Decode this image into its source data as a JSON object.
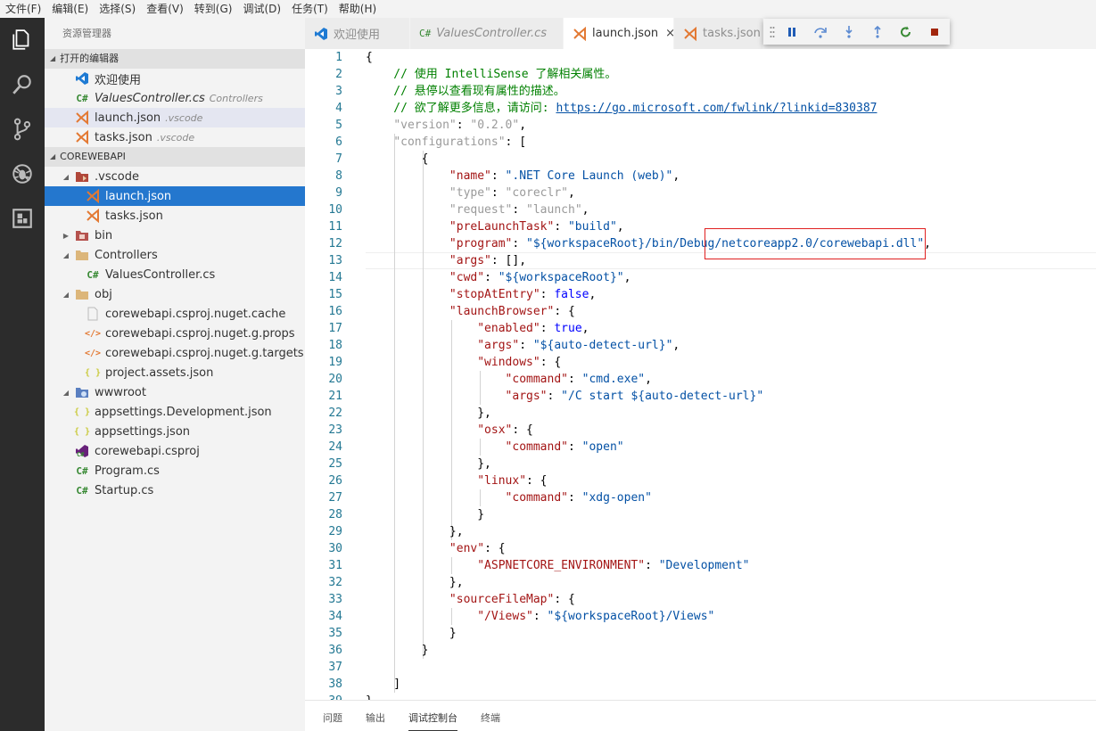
{
  "menu": [
    "文件(F)",
    "编辑(E)",
    "选择(S)",
    "查看(V)",
    "转到(G)",
    "调试(D)",
    "任务(T)",
    "帮助(H)"
  ],
  "sidebar": {
    "title": "资源管理器",
    "open_editors_title": "打开的编辑器",
    "open_editors": [
      {
        "name": "欢迎使用",
        "desc": ""
      },
      {
        "name": "ValuesController.cs",
        "desc": "Controllers"
      },
      {
        "name": "launch.json",
        "desc": ".vscode"
      },
      {
        "name": "tasks.json",
        "desc": ".vscode"
      }
    ],
    "project_title": "COREWEBAPI",
    "tree": [
      {
        "name": ".vscode"
      },
      {
        "name": "launch.json"
      },
      {
        "name": "tasks.json"
      },
      {
        "name": "bin"
      },
      {
        "name": "Controllers"
      },
      {
        "name": "ValuesController.cs"
      },
      {
        "name": "obj"
      },
      {
        "name": "corewebapi.csproj.nuget.cache"
      },
      {
        "name": "corewebapi.csproj.nuget.g.props"
      },
      {
        "name": "corewebapi.csproj.nuget.g.targets"
      },
      {
        "name": "project.assets.json"
      },
      {
        "name": "wwwroot"
      },
      {
        "name": "appsettings.Development.json"
      },
      {
        "name": "appsettings.json"
      },
      {
        "name": "corewebapi.csproj"
      },
      {
        "name": "Program.cs"
      },
      {
        "name": "Startup.cs"
      }
    ]
  },
  "tabs": [
    {
      "label": "欢迎使用"
    },
    {
      "label": "ValuesController.cs"
    },
    {
      "label": "launch.json"
    },
    {
      "label": "tasks.json"
    }
  ],
  "tab_close_glyph": "×",
  "cs_glyph": "C#",
  "brace_glyph": "{ }",
  "xml_glyph": "</>",
  "panel_tabs": [
    "问题",
    "输出",
    "调试控制台",
    "终端"
  ],
  "editor": {
    "lines": [
      [
        [
          "p",
          "{"
        ]
      ],
      [
        [
          "c",
          "    // 使用 IntelliSense 了解相关属性。"
        ]
      ],
      [
        [
          "c",
          "    // 悬停以查看现有属性的描述。"
        ]
      ],
      [
        [
          "c",
          "    // 欲了解更多信息，请访问: "
        ],
        [
          "u",
          "https://go.microsoft.com/fwlink/?linkid=830387"
        ]
      ],
      [
        [
          "p",
          "    "
        ],
        [
          "kg",
          "\"version\""
        ],
        [
          "p",
          ": "
        ],
        [
          "kg",
          "\"0.2.0\""
        ],
        [
          "p",
          ","
        ]
      ],
      [
        [
          "p",
          "    "
        ],
        [
          "kg",
          "\"configurations\""
        ],
        [
          "p",
          ": ["
        ]
      ],
      [
        [
          "p",
          "        {"
        ]
      ],
      [
        [
          "p",
          "            "
        ],
        [
          "k",
          "\"name\""
        ],
        [
          "p",
          ": "
        ],
        [
          "s",
          "\".NET Core Launch (web)\""
        ],
        [
          "p",
          ","
        ]
      ],
      [
        [
          "p",
          "            "
        ],
        [
          "kg",
          "\"type\""
        ],
        [
          "p",
          ": "
        ],
        [
          "kg",
          "\"coreclr\""
        ],
        [
          "p",
          ","
        ]
      ],
      [
        [
          "p",
          "            "
        ],
        [
          "kg",
          "\"request\""
        ],
        [
          "p",
          ": "
        ],
        [
          "kg",
          "\"launch\""
        ],
        [
          "p",
          ","
        ]
      ],
      [
        [
          "p",
          "            "
        ],
        [
          "k",
          "\"preLaunchTask\""
        ],
        [
          "p",
          ": "
        ],
        [
          "s",
          "\"build\""
        ],
        [
          "p",
          ","
        ]
      ],
      [
        [
          "p",
          "            "
        ],
        [
          "k",
          "\"program\""
        ],
        [
          "p",
          ": "
        ],
        [
          "s",
          "\"${workspaceRoot}/bin/Debug/netcoreapp2.0/corewebapi.dll\""
        ],
        [
          "p",
          ","
        ]
      ],
      [
        [
          "p",
          "            "
        ],
        [
          "k",
          "\"args\""
        ],
        [
          "p",
          ": [],"
        ]
      ],
      [
        [
          "p",
          "            "
        ],
        [
          "k",
          "\"cwd\""
        ],
        [
          "p",
          ": "
        ],
        [
          "s",
          "\"${workspaceRoot}\""
        ],
        [
          "p",
          ","
        ]
      ],
      [
        [
          "p",
          "            "
        ],
        [
          "k",
          "\"stopAtEntry\""
        ],
        [
          "p",
          ": "
        ],
        [
          "kw",
          "false"
        ],
        [
          "p",
          ","
        ]
      ],
      [
        [
          "p",
          "            "
        ],
        [
          "k",
          "\"launchBrowser\""
        ],
        [
          "p",
          ": {"
        ]
      ],
      [
        [
          "p",
          "                "
        ],
        [
          "k",
          "\"enabled\""
        ],
        [
          "p",
          ": "
        ],
        [
          "kw",
          "true"
        ],
        [
          "p",
          ","
        ]
      ],
      [
        [
          "p",
          "                "
        ],
        [
          "k",
          "\"args\""
        ],
        [
          "p",
          ": "
        ],
        [
          "s",
          "\"${auto-detect-url}\""
        ],
        [
          "p",
          ","
        ]
      ],
      [
        [
          "p",
          "                "
        ],
        [
          "k",
          "\"windows\""
        ],
        [
          "p",
          ": {"
        ]
      ],
      [
        [
          "p",
          "                    "
        ],
        [
          "k",
          "\"command\""
        ],
        [
          "p",
          ": "
        ],
        [
          "s",
          "\"cmd.exe\""
        ],
        [
          "p",
          ","
        ]
      ],
      [
        [
          "p",
          "                    "
        ],
        [
          "k",
          "\"args\""
        ],
        [
          "p",
          ": "
        ],
        [
          "s",
          "\"/C start ${auto-detect-url}\""
        ]
      ],
      [
        [
          "p",
          "                },"
        ]
      ],
      [
        [
          "p",
          "                "
        ],
        [
          "k",
          "\"osx\""
        ],
        [
          "p",
          ": {"
        ]
      ],
      [
        [
          "p",
          "                    "
        ],
        [
          "k",
          "\"command\""
        ],
        [
          "p",
          ": "
        ],
        [
          "s",
          "\"open\""
        ]
      ],
      [
        [
          "p",
          "                },"
        ]
      ],
      [
        [
          "p",
          "                "
        ],
        [
          "k",
          "\"linux\""
        ],
        [
          "p",
          ": {"
        ]
      ],
      [
        [
          "p",
          "                    "
        ],
        [
          "k",
          "\"command\""
        ],
        [
          "p",
          ": "
        ],
        [
          "s",
          "\"xdg-open\""
        ]
      ],
      [
        [
          "p",
          "                }"
        ]
      ],
      [
        [
          "p",
          "            },"
        ]
      ],
      [
        [
          "p",
          "            "
        ],
        [
          "k",
          "\"env\""
        ],
        [
          "p",
          ": {"
        ]
      ],
      [
        [
          "p",
          "                "
        ],
        [
          "k",
          "\"ASPNETCORE_ENVIRONMENT\""
        ],
        [
          "p",
          ": "
        ],
        [
          "s",
          "\"Development\""
        ]
      ],
      [
        [
          "p",
          "            },"
        ]
      ],
      [
        [
          "p",
          "            "
        ],
        [
          "k",
          "\"sourceFileMap\""
        ],
        [
          "p",
          ": {"
        ]
      ],
      [
        [
          "p",
          "                "
        ],
        [
          "k",
          "\"/Views\""
        ],
        [
          "p",
          ": "
        ],
        [
          "s",
          "\"${workspaceRoot}/Views\""
        ]
      ],
      [
        [
          "p",
          "            }"
        ]
      ],
      [
        [
          "p",
          "        }"
        ]
      ],
      [
        [
          "p",
          ""
        ]
      ],
      [
        [
          "p",
          "    ]"
        ]
      ],
      [
        [
          "p",
          "}"
        ]
      ]
    ]
  },
  "colors": {
    "activitybar": "#2c2c2c",
    "selection_blue": "#2477ce",
    "highlight_box": "#e02020"
  }
}
